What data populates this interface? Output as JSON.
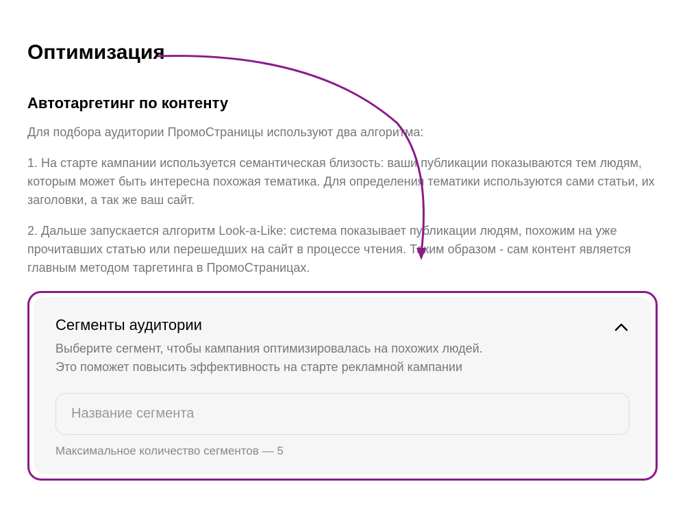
{
  "heading": "Оптимизация",
  "subheading": "Автотаргетинг по контенту",
  "intro": "Для подбора аудитории ПромоСтраницы используют два алгоритма:",
  "para1": "1. На старте кампании используется семантическая близость: ваши публикации показываются тем людям, которым может быть интересна похожая тематика. Для определения тематики используются сами статьи, их заголовки, а так же ваш сайт.",
  "para2": "2. Дальше запускается алгоритм Look-a-Like: система показывает публикации людям, похожим на уже прочитавших статью или перешедших на сайт в процессе чтения. Таким образом - сам контент является главным методом таргетинга в ПромоСтраницах.",
  "panel": {
    "title": "Сегменты аудитории",
    "desc_line1": "Выберите сегмент, чтобы кампания оптимизировалась на похожих людей.",
    "desc_line2": "Это поможет повысить эффективность на старте рекламной кампании",
    "placeholder": "Название сегмента",
    "hint": "Максимальное количество сегментов — 5"
  },
  "colors": {
    "accent": "#8b1a8b"
  }
}
